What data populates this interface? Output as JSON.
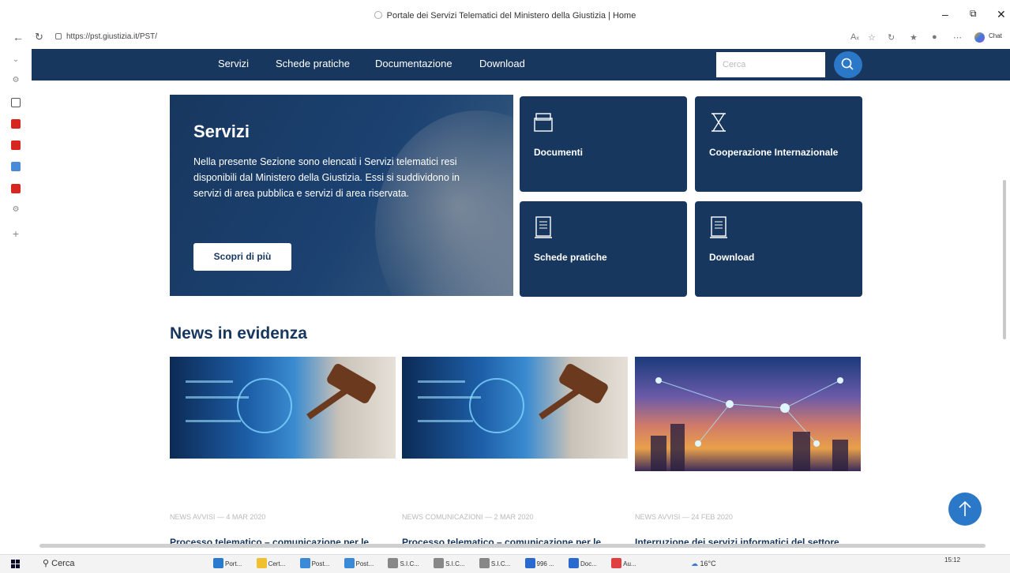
{
  "window": {
    "title": "Portale dei Servizi Telematici del Ministero della Giustizia | Home"
  },
  "browser": {
    "url": "https://pst.giustizia.it/PST/",
    "copilot_label": "Chat"
  },
  "nav": {
    "items": [
      "Servizi",
      "Schede pratiche",
      "Documentazione",
      "Download"
    ],
    "search_placeholder": "Cerca"
  },
  "hero": {
    "title": "Servizi",
    "description": "Nella presente Sezione sono elencati i Servizi telematici resi disponibili dal Ministero della Giustizia. Essi si suddividono in servizi di area pubblica e servizi di area riservata.",
    "button": "Scopri di più"
  },
  "tiles": [
    {
      "label": "Documenti",
      "icon": "folder-icon"
    },
    {
      "label": "Cooperazione Internazionale",
      "icon": "hourglass-icon"
    },
    {
      "label": "Schede pratiche",
      "icon": "document-icon"
    },
    {
      "label": "Download",
      "icon": "document-icon"
    }
  ],
  "news": {
    "title": "News in evidenza",
    "cards": [
      {
        "category": "NEWS AVVISI",
        "date": "4 MAR 2020",
        "headline": "Processo telematico – comunicazione per le"
      },
      {
        "category": "NEWS COMUNICAZIONI",
        "date": "2 MAR 2020",
        "headline": "Processo telematico – comunicazione per le"
      },
      {
        "category": "NEWS AVVISI",
        "date": "24 FEB 2020",
        "headline": "Interruzione dei servizi informatici del settore"
      }
    ]
  },
  "taskbar": {
    "search": "Cerca",
    "apps": [
      "Port...",
      "Cert...",
      "Post...",
      "Post...",
      "S.I.C...",
      "S.I.C...",
      "S.I.C...",
      "996 ...",
      "Doc...",
      "Au..."
    ],
    "temperature": "16°C",
    "time": "15:12"
  },
  "colors": {
    "brand": "#17375e",
    "accent": "#2b77c8"
  }
}
